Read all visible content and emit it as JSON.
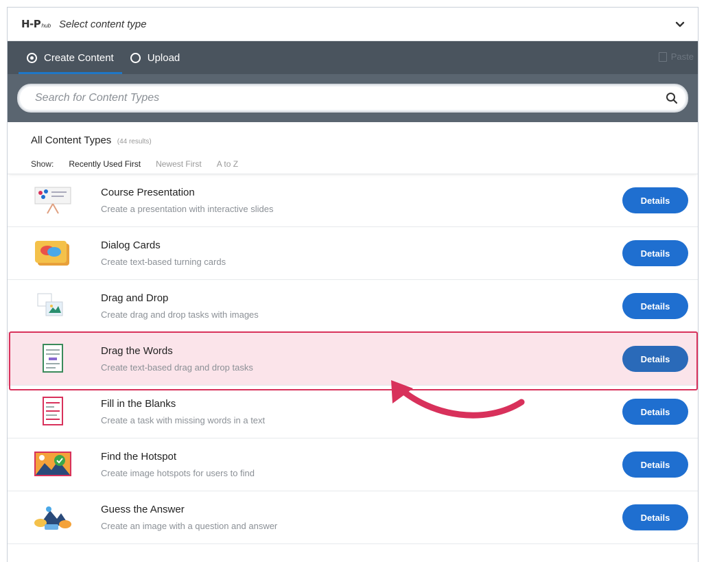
{
  "header": {
    "logo_main": "H-P",
    "logo_sub": "hub",
    "title": "Select content type"
  },
  "tabs": [
    {
      "label": "Create Content",
      "active": true
    },
    {
      "label": "Upload",
      "active": false
    }
  ],
  "paste_label": "Paste",
  "search": {
    "placeholder": "Search for Content Types"
  },
  "results": {
    "title": "All Content Types",
    "count": "(44 results)",
    "show_label": "Show:",
    "sort_options": [
      {
        "label": "Recently Used First",
        "active": true
      },
      {
        "label": "Newest First",
        "active": false
      },
      {
        "label": "A to Z",
        "active": false
      }
    ]
  },
  "details_label": "Details",
  "items": [
    {
      "name": "Course Presentation",
      "desc": "Create a presentation with interactive slides"
    },
    {
      "name": "Dialog Cards",
      "desc": "Create text-based turning cards"
    },
    {
      "name": "Drag and Drop",
      "desc": "Create drag and drop tasks with images"
    },
    {
      "name": "Drag the Words",
      "desc": "Create text-based drag and drop tasks",
      "highlighted": true
    },
    {
      "name": "Fill in the Blanks",
      "desc": "Create a task with missing words in a text"
    },
    {
      "name": "Find the Hotspot",
      "desc": "Create image hotspots for users to find"
    },
    {
      "name": "Guess the Answer",
      "desc": "Create an image with a question and answer"
    }
  ],
  "colors": {
    "tabbar": "#4a545e",
    "accent": "#1f6fd0",
    "highlight": "#d8315b"
  }
}
